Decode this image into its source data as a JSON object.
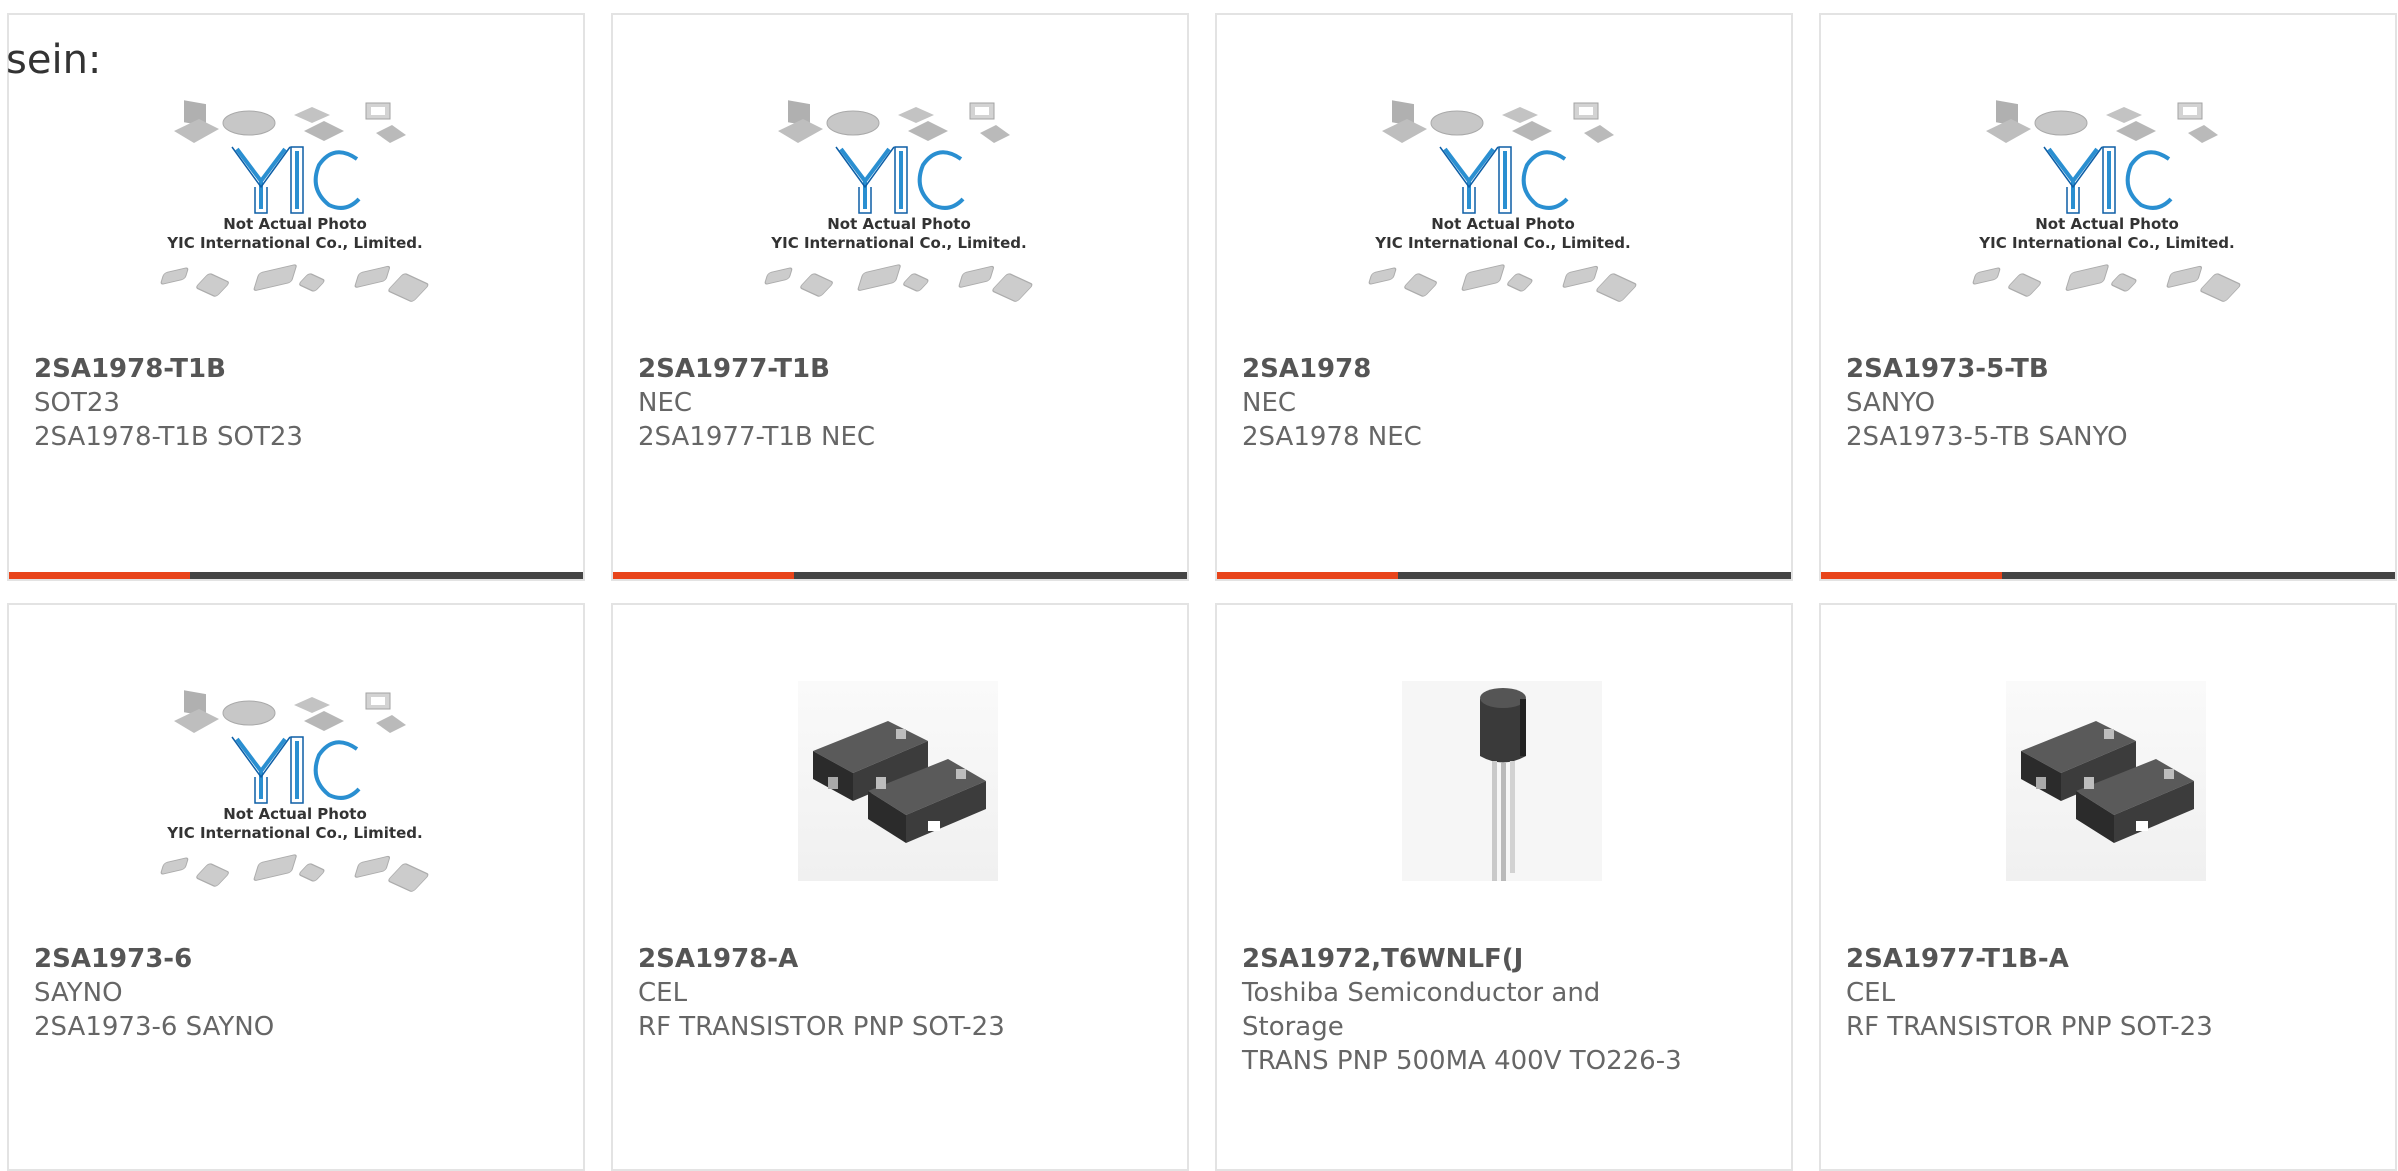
{
  "lead_text": "sein:",
  "placeholder_caption_1": "Not Actual Photo",
  "placeholder_caption_2": "YIC International Co., Limited.",
  "accent_color": "#e8441a",
  "bar_color": "#444444",
  "products": [
    {
      "part": "2SA1978-T1B",
      "maker": "SOT23",
      "desc": "2SA1978-T1B SOT23",
      "image": "placeholder-photo"
    },
    {
      "part": "2SA1977-T1B",
      "maker": "NEC",
      "desc": "2SA1977-T1B NEC",
      "image": "placeholder-photo"
    },
    {
      "part": "2SA1978",
      "maker": "NEC",
      "desc": "2SA1978 NEC",
      "image": "placeholder-photo"
    },
    {
      "part": "2SA1973-5-TB",
      "maker": "SANYO",
      "desc": "2SA1973-5-TB SANYO",
      "image": "placeholder-photo"
    },
    {
      "part": "2SA1973-6",
      "maker": "SAYNO",
      "desc": "2SA1973-6 SAYNO",
      "image": "placeholder-photo"
    },
    {
      "part": "2SA1978-A",
      "maker": "CEL",
      "desc": "RF TRANSISTOR PNP SOT-23",
      "image": "sot23-package"
    },
    {
      "part": "2SA1972,T6WNLF(J",
      "maker": "Toshiba Semiconductor and Storage",
      "desc": "TRANS PNP 500MA 400V TO226-3",
      "image": "to92-package"
    },
    {
      "part": "2SA1977-T1B-A",
      "maker": "CEL",
      "desc": "RF TRANSISTOR PNP SOT-23",
      "image": "sot23-package"
    }
  ]
}
